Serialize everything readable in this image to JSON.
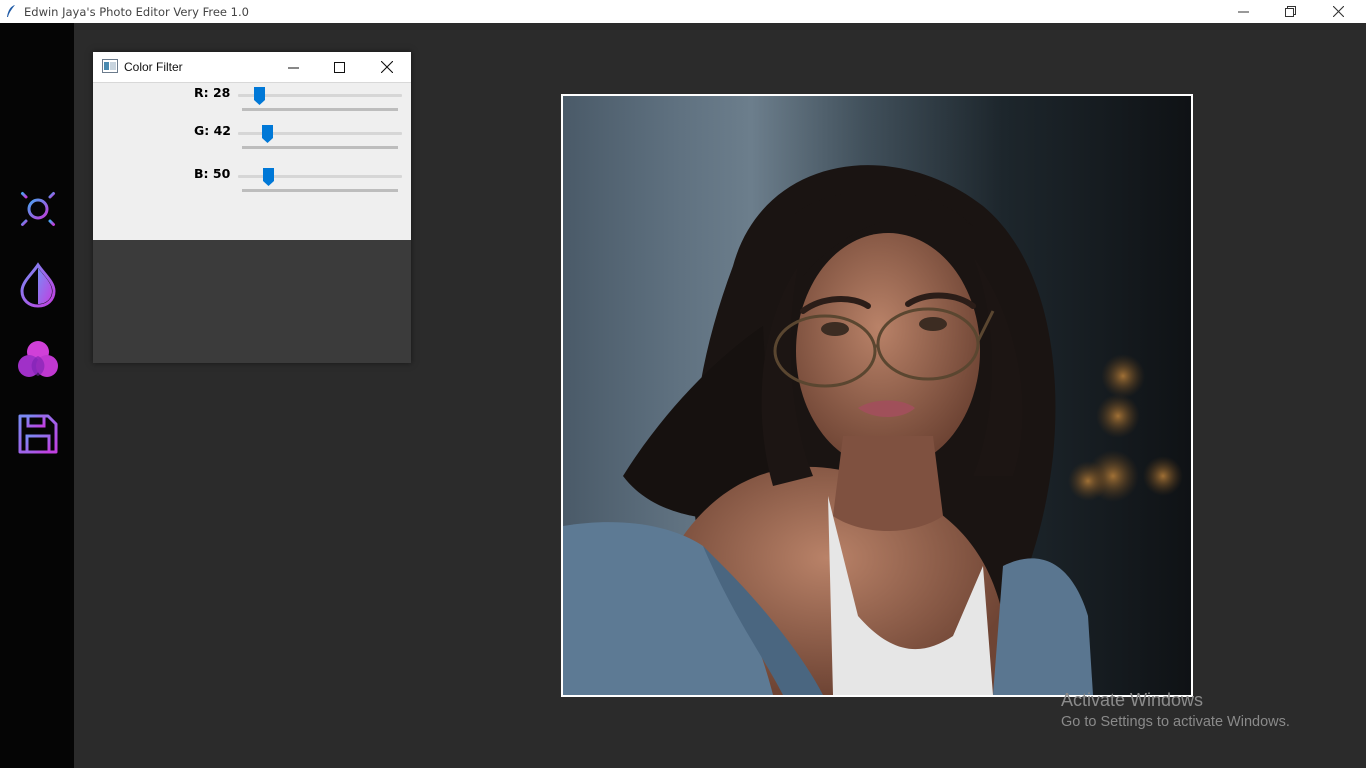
{
  "window": {
    "title": "Edwin Jaya's Photo Editor Very Free 1.0"
  },
  "sidebar": {
    "items": [
      {
        "name": "brightness",
        "icon": "sun-icon"
      },
      {
        "name": "contrast",
        "icon": "drop-icon"
      },
      {
        "name": "color-filter",
        "icon": "color-circles-icon"
      },
      {
        "name": "save",
        "icon": "save-icon"
      }
    ]
  },
  "filter_window": {
    "title": "Color Filter",
    "sliders": [
      {
        "label": "R: 28",
        "value": 28,
        "max": 255
      },
      {
        "label": "G: 42",
        "value": 42,
        "max": 255
      },
      {
        "label": "B: 50",
        "value": 50,
        "max": 255
      }
    ]
  },
  "watermark": {
    "line1": "Activate Windows",
    "line2": "Go to Settings to activate Windows."
  },
  "colors": {
    "accent": "#0078d7",
    "sidebar_gradient_start": "#4aa3f0",
    "sidebar_gradient_end": "#c03cd8"
  }
}
